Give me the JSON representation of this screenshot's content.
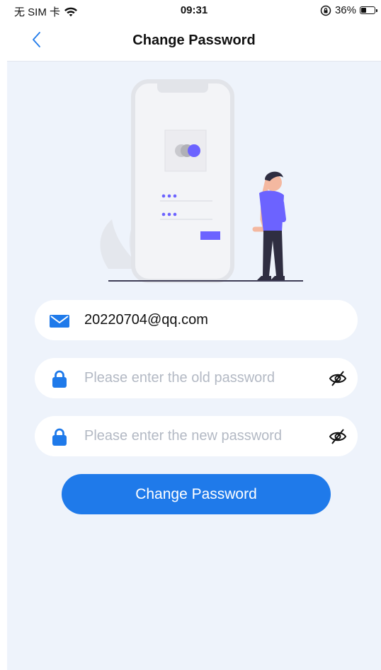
{
  "status_bar": {
    "carrier": "无 SIM 卡",
    "time": "09:31",
    "battery": "36%",
    "battery_level": 0.36,
    "icons": [
      "wifi-icon",
      "orientation-lock-icon",
      "battery-icon"
    ]
  },
  "navbar": {
    "title": "Change Password",
    "back_icon": "chevron-left-icon"
  },
  "form": {
    "email": {
      "value": "20220704@qq.com",
      "icon": "mail-icon"
    },
    "old_password": {
      "placeholder": "Please enter the old password",
      "icon": "lock-icon",
      "toggle_icon": "eye-off-icon"
    },
    "new_password": {
      "placeholder": "Please enter the new password",
      "icon": "lock-icon",
      "toggle_icon": "eye-off-icon"
    },
    "submit_label": "Change Password"
  },
  "colors": {
    "accent": "#1f7aea",
    "background": "#eef3fb",
    "illustration_accent": "#6c63ff",
    "placeholder": "#b3b9c4"
  }
}
